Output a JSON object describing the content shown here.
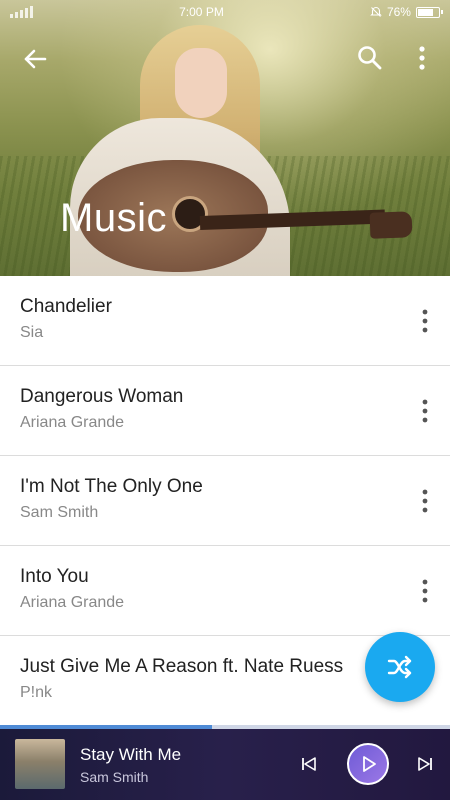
{
  "status_bar": {
    "time": "7:00 PM",
    "battery": "76%",
    "battery_level": 0.76
  },
  "header": {
    "title": "Music",
    "back_icon": "arrow-left-icon",
    "search_icon": "search-icon",
    "menu_icon": "more-vertical-icon"
  },
  "songs": [
    {
      "title": "Chandelier",
      "artist": "Sia"
    },
    {
      "title": "Dangerous Woman",
      "artist": "Ariana Grande"
    },
    {
      "title": "I'm Not The Only One",
      "artist": "Sam Smith"
    },
    {
      "title": "Into You",
      "artist": "Ariana Grande"
    },
    {
      "title": "Just Give Me A Reason ft. Nate Ruess",
      "artist": "P!nk"
    }
  ],
  "fab": {
    "icon": "shuffle-icon",
    "color": "#1aa9f0"
  },
  "player": {
    "title": "Stay With Me",
    "artist": "Sam Smith",
    "progress": 0.47,
    "prev_icon": "skip-previous-icon",
    "play_icon": "play-icon",
    "next_icon": "skip-next-icon"
  },
  "colors": {
    "accent": "#1aa9f0",
    "player_bg": "#1b1a3a",
    "play_button": "#8a6ee0"
  }
}
